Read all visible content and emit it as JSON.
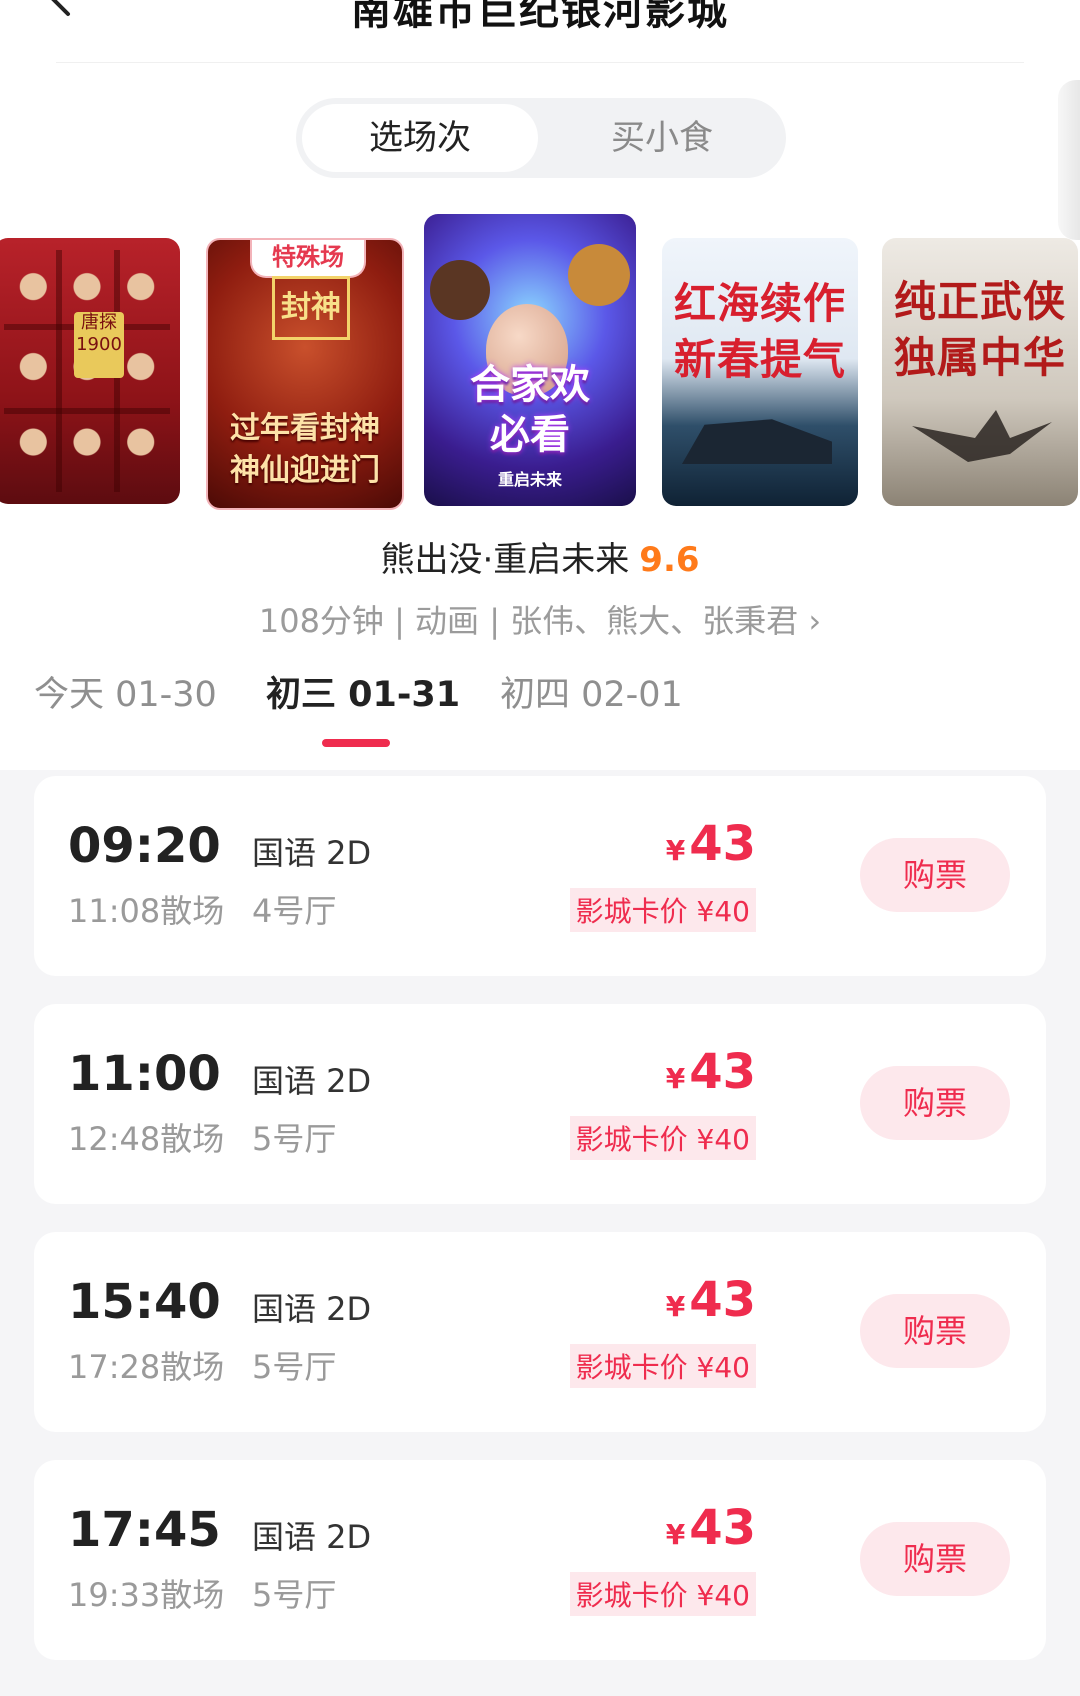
{
  "header": {
    "title": "南雄市巨纪银河影城"
  },
  "segment": {
    "tabs": [
      "选场次",
      "买小食"
    ],
    "active": "选场次"
  },
  "posters": [
    {
      "title": "唐探1900",
      "text": "唐探1900"
    },
    {
      "badge": "特殊场",
      "seal": "封神",
      "text": "过年看封神\n神仙迎进门"
    },
    {
      "text": "合家欢\n必看",
      "sub": "重启未来"
    },
    {
      "text": "红海续作\n新春提气"
    },
    {
      "text": "纯正武侠\n独属中华"
    }
  ],
  "movie": {
    "title": "熊出没·重启未来",
    "score": "9.6",
    "meta": "108分钟 | 动画 | 张伟、熊大、张秉君 ›"
  },
  "dates": [
    {
      "label": "今天 01-30"
    },
    {
      "label": "初三 01-31"
    },
    {
      "label": "初四 02-01"
    }
  ],
  "showtimes": [
    {
      "start": "09:20",
      "end": "11:08散场",
      "lang": "国语 2D",
      "hall": "4号厅",
      "yen": "¥",
      "price": "43",
      "card_price": "影城卡价 ¥40",
      "buy": "购票"
    },
    {
      "start": "11:00",
      "end": "12:48散场",
      "lang": "国语 2D",
      "hall": "5号厅",
      "yen": "¥",
      "price": "43",
      "card_price": "影城卡价 ¥40",
      "buy": "购票"
    },
    {
      "start": "15:40",
      "end": "17:28散场",
      "lang": "国语 2D",
      "hall": "5号厅",
      "yen": "¥",
      "price": "43",
      "card_price": "影城卡价 ¥40",
      "buy": "购票"
    },
    {
      "start": "17:45",
      "end": "19:33散场",
      "lang": "国语 2D",
      "hall": "5号厅",
      "yen": "¥",
      "price": "43",
      "card_price": "影城卡价 ¥40",
      "buy": "购票"
    }
  ],
  "colors": {
    "accent": "#ef2c4e",
    "score": "#ff7a1a",
    "muted": "#9a9a9a"
  },
  "icons": {
    "back": "chevron-left-icon"
  }
}
